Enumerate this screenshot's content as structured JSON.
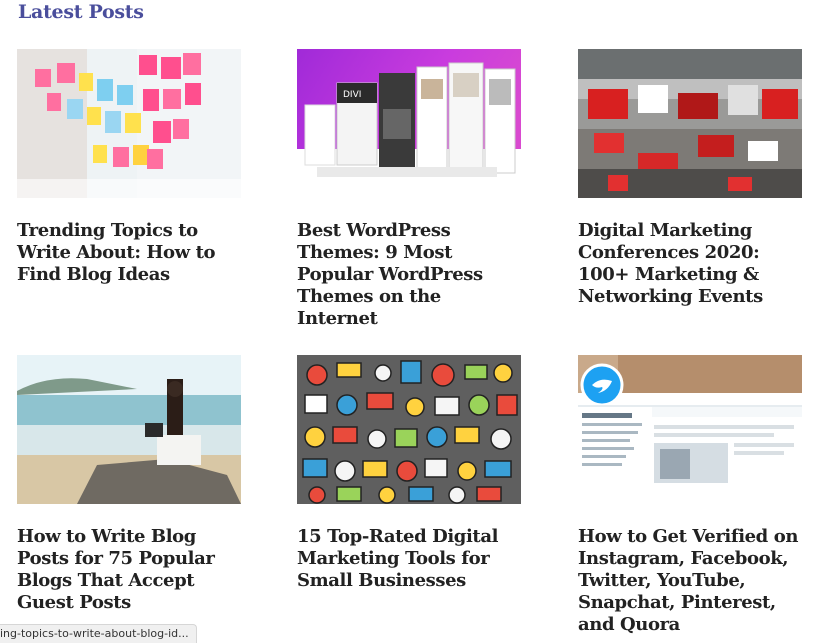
{
  "section": {
    "title": "Latest Posts"
  },
  "posts": [
    {
      "title": "Trending Topics to Write About: How to Find Blog Ideas"
    },
    {
      "title": "Best WordPress Themes: 9 Most Popular WordPress Themes on the Internet"
    },
    {
      "title": "Digital Marketing Conferences 2020: 100+ Marketing & Networking Events"
    },
    {
      "title": "How to Write Blog Posts for 75 Popular Blogs That Accept Guest Posts"
    },
    {
      "title": "15 Top-Rated Digital Marketing Tools for Small Businesses"
    },
    {
      "title": "How to Get Verified on Instagram, Facebook, Twitter, YouTube, Snapchat, Pinterest, and Quora"
    }
  ],
  "twitter_mock": {
    "handle": "Twitter",
    "tabs": [
      "Tweets",
      "Tweets & replies",
      "Media"
    ]
  },
  "status_bar": {
    "url": "ing-topics-to-write-about-blog-id..."
  },
  "colors": {
    "accent": "#4a4e9c",
    "title": "#222222",
    "twitter": "#1da1f2"
  }
}
